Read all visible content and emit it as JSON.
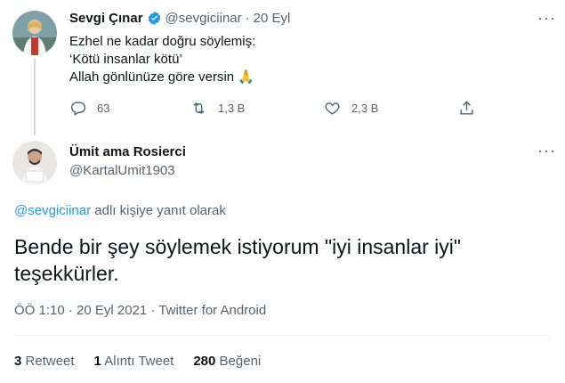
{
  "original_tweet": {
    "display_name": "Sevgi Çınar",
    "handle": "@sevgiciinar",
    "separator": "·",
    "date": "20 Eyl",
    "verified_icon": "verified-badge-icon",
    "lines": [
      "Ezhel ne kadar doğru söylemiş:",
      "‘Kötü insanlar kötü’",
      "Allah gönlünüze göre versin"
    ],
    "emoji": "🙏",
    "actions": {
      "reply_count": "63",
      "retweet_count": "1,3 B",
      "like_count": "2,3 B"
    }
  },
  "reply_tweet": {
    "display_name": "Ümit ama Rosierci",
    "handle": "@KartalUmit1903",
    "replying_mention": "@sevgiciinar",
    "replying_suffix": "adlı kişiye yanıt olarak",
    "text_line1": "Bende bir şey söylemek istiyorum \"iyi insanlar iyi\"",
    "text_line2": "teşekkürler.",
    "meta": "ÖÖ 1:10 · 20 Eyl 2021 · Twitter for Android"
  },
  "stats": {
    "retweets_count": "3",
    "retweets_label": "Retweet",
    "quotes_count": "1",
    "quotes_label": "Alıntı Tweet",
    "likes_count": "280",
    "likes_label": "Beğeni"
  },
  "more_glyph": "···",
  "colors": {
    "accent": "#1d9bf0",
    "muted": "#536471",
    "text": "#0f1419"
  }
}
